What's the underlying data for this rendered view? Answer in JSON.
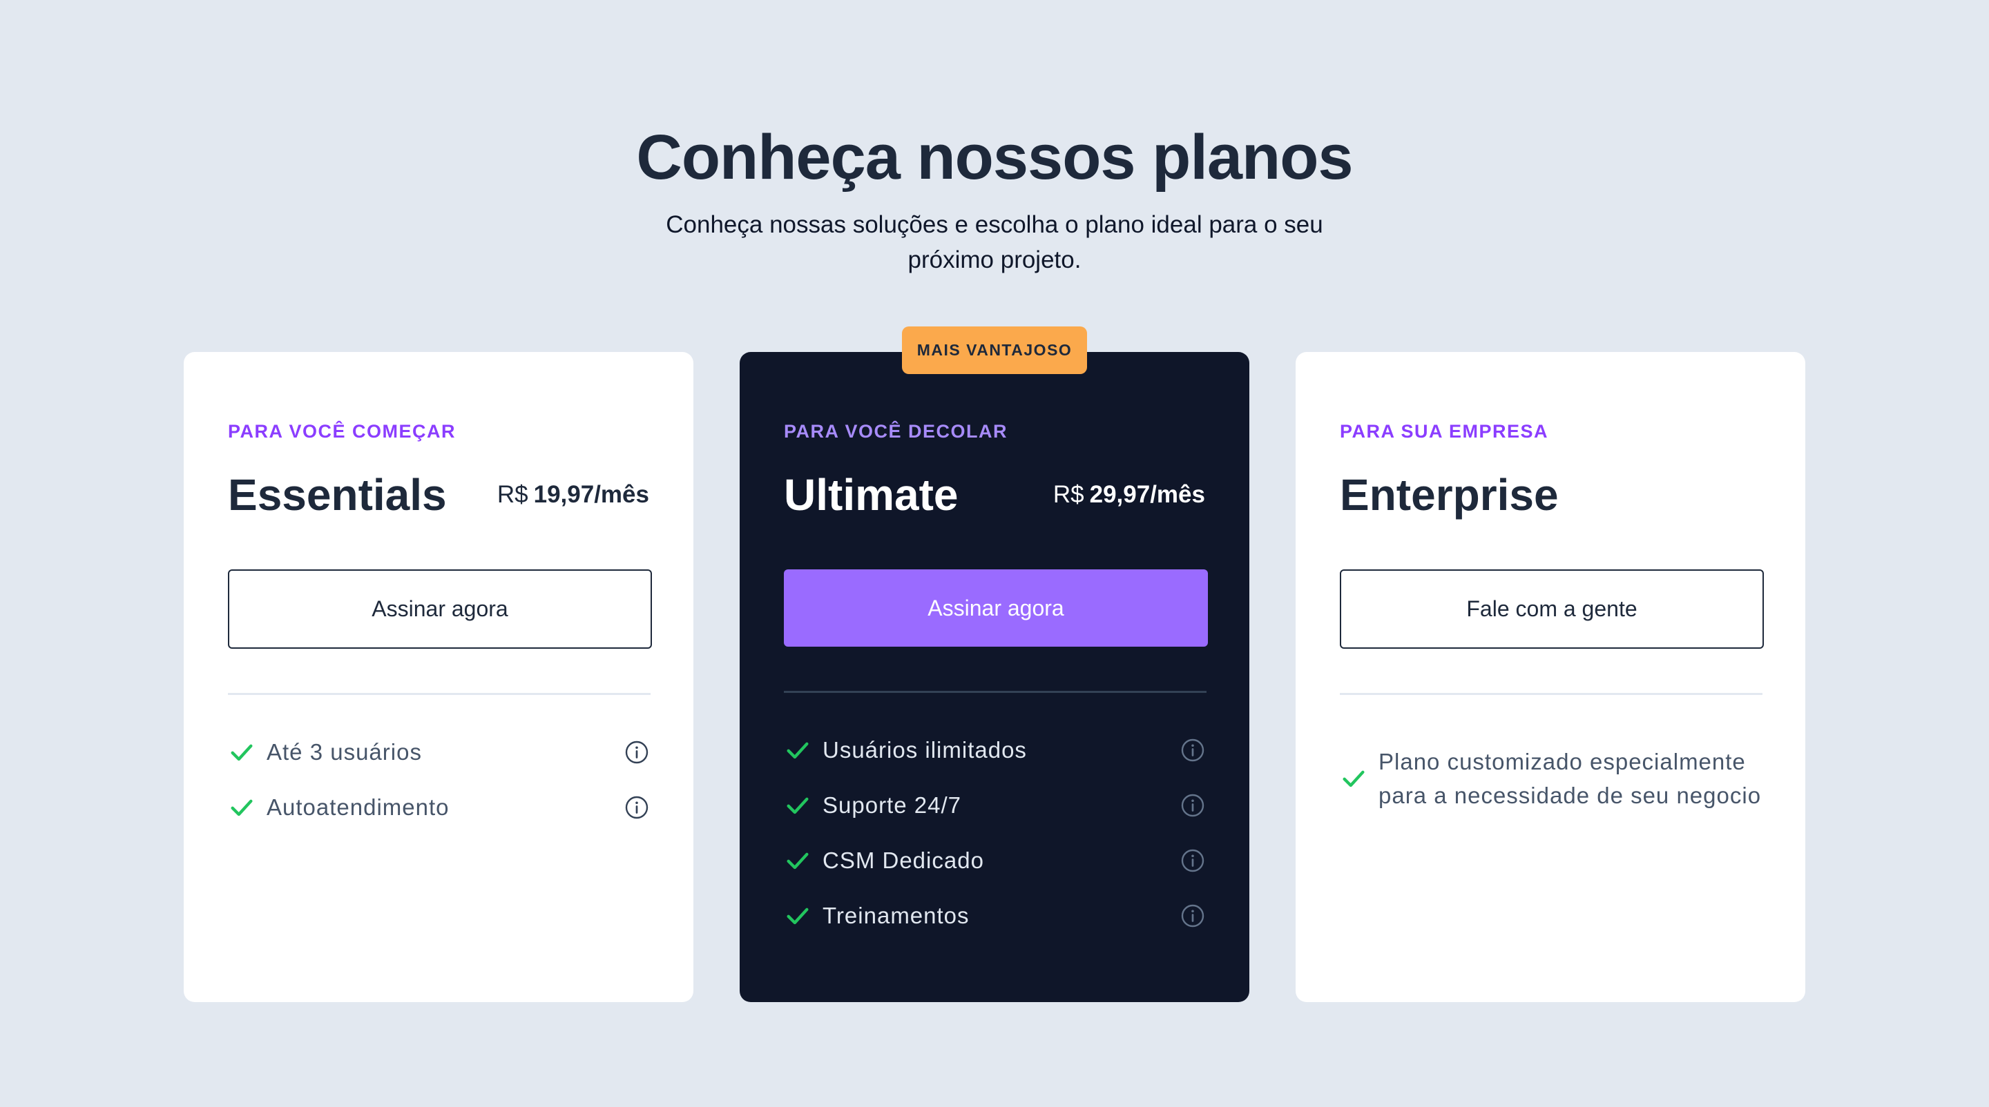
{
  "header": {
    "title": "Conheça nossos planos",
    "subtitle": "Conheça nossas soluções e escolha o plano ideal para o seu próximo projeto."
  },
  "colors": {
    "background": "#e2e8f0",
    "accent_purple": "#8b3dff",
    "cta_purple": "#9a6bff",
    "badge_orange": "#fba94c",
    "dark_card": "#0f1629",
    "check_green": "#22c55e"
  },
  "plans": [
    {
      "eyebrow": "PARA VOCÊ COMEÇAR",
      "name": "Essentials",
      "price_currency": "R$",
      "price_amount": "19,97/mês",
      "cta_label": "Assinar agora",
      "features": [
        {
          "label": "Até 3 usuários",
          "icon": "check-icon",
          "info_icon": "info-icon"
        },
        {
          "label": "Autoatendimento",
          "icon": "check-icon",
          "info_icon": "info-icon"
        }
      ]
    },
    {
      "badge": "MAIS VANTAJOSO",
      "eyebrow": "PARA VOCÊ DECOLAR",
      "name": "Ultimate",
      "price_currency": "R$",
      "price_amount": "29,97/mês",
      "cta_label": "Assinar agora",
      "features": [
        {
          "label": "Usuários ilimitados",
          "icon": "check-icon",
          "info_icon": "info-icon"
        },
        {
          "label": "Suporte 24/7",
          "icon": "check-icon",
          "info_icon": "info-icon"
        },
        {
          "label": "CSM Dedicado",
          "icon": "check-icon",
          "info_icon": "info-icon"
        },
        {
          "label": "Treinamentos",
          "icon": "check-icon",
          "info_icon": "info-icon"
        }
      ]
    },
    {
      "eyebrow": "PARA SUA EMPRESA",
      "name": "Enterprise",
      "cta_label": "Fale com a gente",
      "features": [
        {
          "label": "Plano customizado especialmente para a necessidade de seu negocio",
          "icon": "check-icon"
        }
      ]
    }
  ]
}
